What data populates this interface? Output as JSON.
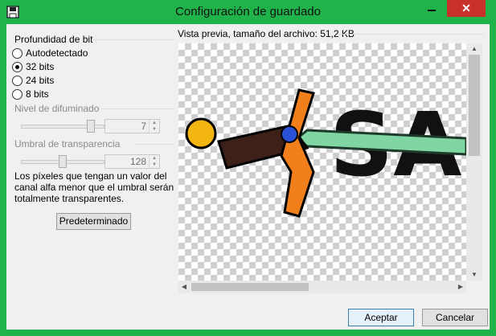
{
  "window": {
    "title": "Configuración de guardado",
    "icons": {
      "app": "floppy-disk-icon",
      "minimize": "minimize-icon",
      "close": "close-icon"
    },
    "close_glyph": "✕",
    "colors": {
      "frame": "#1fb34a",
      "close": "#c7312a",
      "client": "#f0f0f0"
    }
  },
  "left": {
    "bit_depth": {
      "title": "Profundidad de bit",
      "options": [
        "Autodetectado",
        "32 bits",
        "24 bits",
        "8 bits"
      ],
      "selected": "32 bits"
    },
    "dither": {
      "label": "Nivel de difuminado",
      "value": "7",
      "level": 7,
      "max": 8
    },
    "threshold": {
      "label": "Umbral de transparencia",
      "value": "128",
      "level": 128,
      "max": 255
    },
    "help_text": "Los píxeles que tengan un valor del canal alfa menor que el umbral serán totalmente transparentes.",
    "default_button": "Predeterminado"
  },
  "preview": {
    "label": "Vista previa, tamaño del archivo: 51,2 KB",
    "image": "sword-logo-preview",
    "image_text": "SA"
  },
  "buttons": {
    "ok": "Aceptar",
    "cancel": "Cancelar"
  }
}
